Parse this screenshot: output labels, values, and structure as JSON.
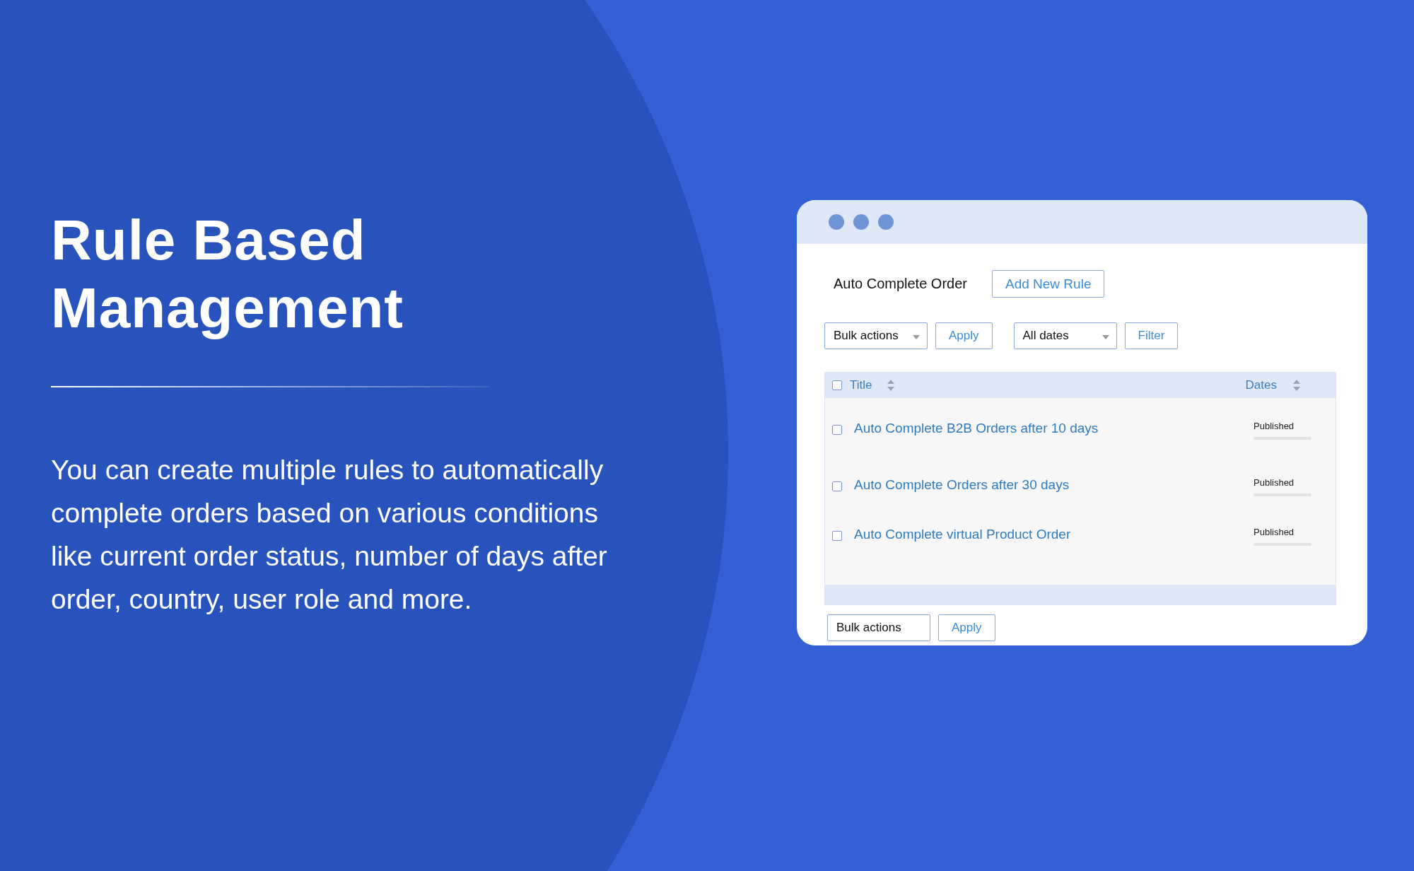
{
  "hero": {
    "title": "Rule Based Management",
    "description": "You can create multiple rules to automatically complete orders based on various conditions like current order status, number of days after order, country, user role and more."
  },
  "window": {
    "heading": "Auto Complete Order",
    "add_button": "Add New Rule",
    "top_toolbar": {
      "bulk_select": "Bulk actions",
      "apply": "Apply",
      "date_select": "All dates",
      "filter": "Filter"
    },
    "table": {
      "select_all_checked": false,
      "columns": [
        "Title",
        "Dates"
      ],
      "rows": [
        {
          "title": "Auto Complete B2B Orders after 10 days",
          "status": "Published",
          "checked": false
        },
        {
          "title": "Auto Complete Orders after 30 days",
          "status": "Published",
          "checked": false
        },
        {
          "title": "Auto Complete virtual Product Order",
          "status": "Published",
          "checked": false
        }
      ]
    },
    "bottom_toolbar": {
      "bulk_select": "Bulk actions",
      "apply": "Apply"
    }
  }
}
